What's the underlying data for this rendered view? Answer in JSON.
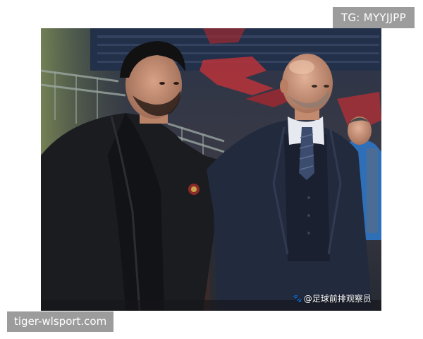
{
  "badges": {
    "telegram": "TG: MYYJJPP",
    "site": "tiger-wlsport.com"
  },
  "photo": {
    "watermark_text": "@足球前排观察员",
    "watermark_icon": "paw-icon"
  },
  "colors": {
    "badge_bg": "#9c9c9c",
    "badge_text": "#ffffff"
  }
}
